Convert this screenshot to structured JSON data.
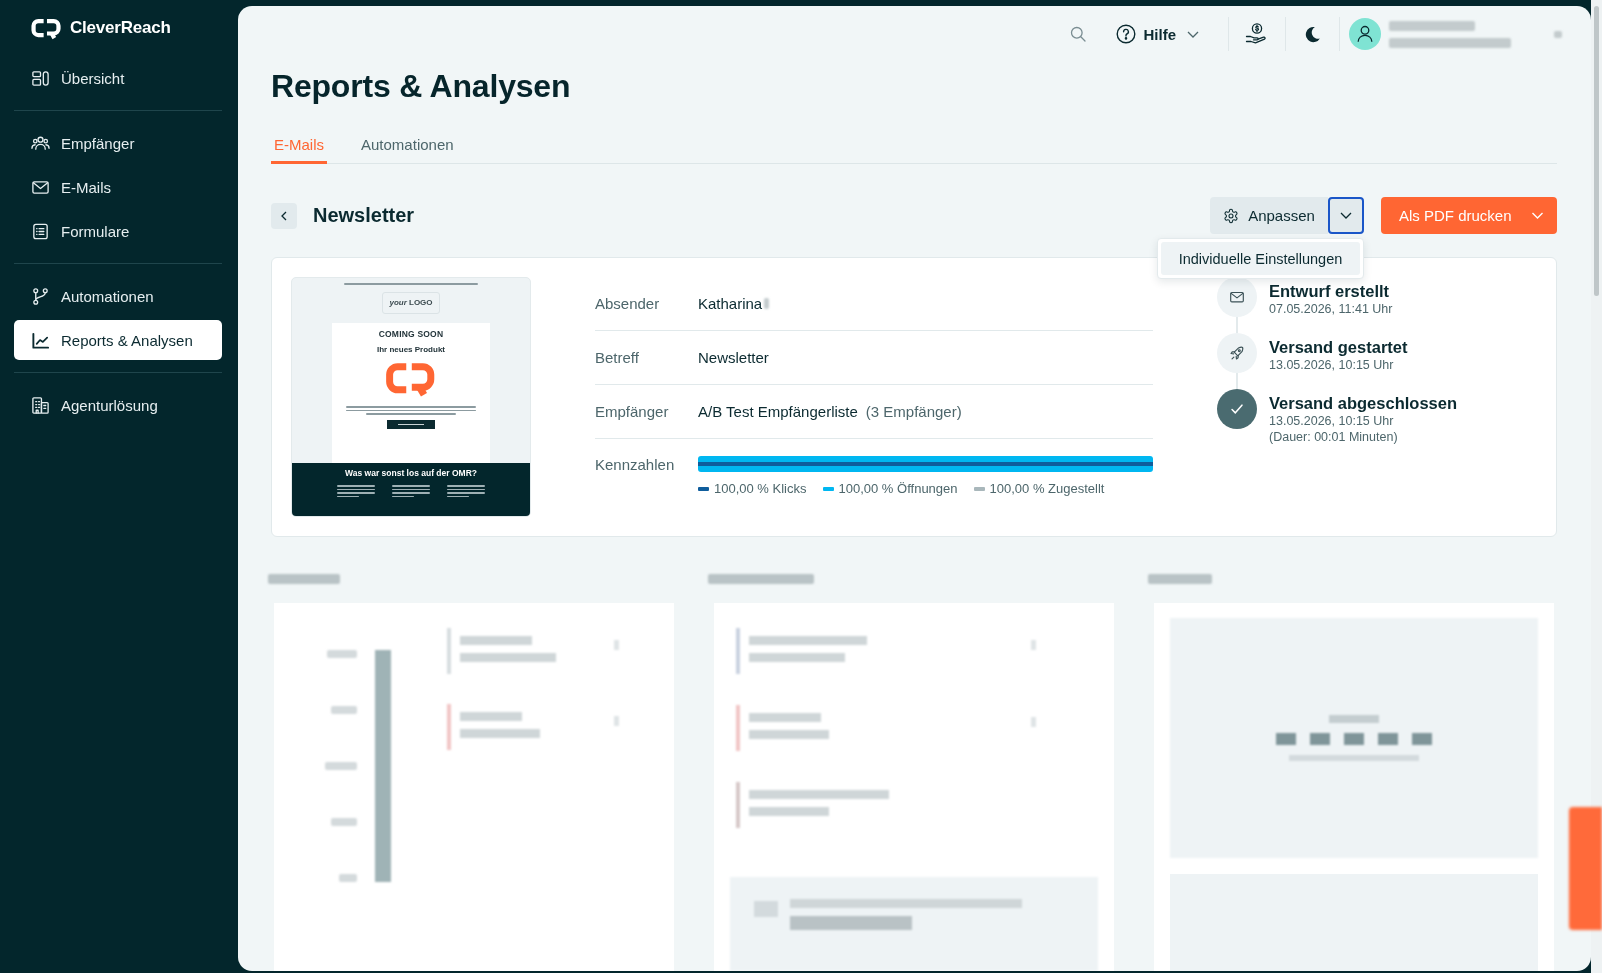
{
  "sidebar": {
    "logo": "CleverReach",
    "groups": [
      {
        "items": [
          {
            "label": "Übersicht",
            "selected": false
          }
        ]
      },
      {
        "items": [
          {
            "label": "Empfänger",
            "selected": false
          },
          {
            "label": "E-Mails",
            "selected": false
          },
          {
            "label": "Formulare",
            "selected": false
          }
        ]
      },
      {
        "items": [
          {
            "label": "Automationen",
            "selected": false
          },
          {
            "label": "Reports & Analysen",
            "selected": true
          }
        ]
      },
      {
        "items": [
          {
            "label": "Agenturlösung",
            "selected": false
          }
        ]
      }
    ]
  },
  "header": {
    "help": "Hilfe"
  },
  "page": {
    "title": "Reports & Analysen",
    "tabs": [
      {
        "label": "E-Mails",
        "selected": true
      },
      {
        "label": "Automationen",
        "selected": false
      }
    ]
  },
  "report": {
    "title": "Newsletter",
    "customize": {
      "label": "Anpassen",
      "menu_open": true,
      "menu": [
        {
          "label": "Individuelle Einstellungen",
          "highlighted": true
        }
      ]
    },
    "print_button": "Als PDF drucken",
    "preview": {
      "logo": "*your* LOGO",
      "headline": "COMING SOON",
      "subline": "Ihr neues Produkt",
      "footer_title": "Was war sonst los auf der OMR?"
    },
    "details": [
      {
        "label": "Absender",
        "value": "Katharina",
        "redacted": true
      },
      {
        "label": "Betreff",
        "value": "Newsletter",
        "redacted": false
      },
      {
        "label": "Empfänger",
        "value": "A/B Test Empfängerliste",
        "note": "(3 Empfänger)",
        "redacted": false
      }
    ],
    "metrics": {
      "label": "Kennzahlen",
      "items": [
        {
          "label": "100,00 % Klicks",
          "color": "#0f5d9c",
          "level": 1
        },
        {
          "label": "100,00 % Öffnungen",
          "color": "#00b7f1",
          "level": 1
        },
        {
          "label": "100,00 % Zugestellt",
          "color": "#a9b7bb"
        }
      ]
    },
    "timeline": [
      {
        "title": "Entwurf erstellt",
        "lines": [
          "07.05.2026, 11:41 Uhr"
        ],
        "done": false
      },
      {
        "title": "Versand gestartet",
        "lines": [
          "13.05.2026, 10:15 Uhr"
        ],
        "done": false
      },
      {
        "title": "Versand abgeschlossen",
        "lines": [
          "13.05.2026, 10:15 Uhr",
          "(Dauer: 00:01 Minuten)"
        ],
        "done": true
      }
    ]
  }
}
